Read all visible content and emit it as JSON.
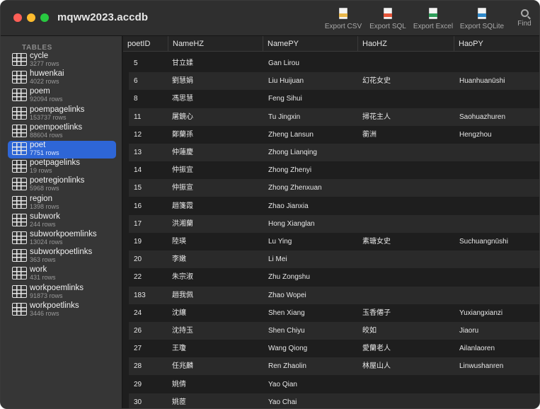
{
  "window": {
    "title": "mqww2023.accdb"
  },
  "toolbar": {
    "buttons": [
      {
        "label": "Export CSV",
        "color": "#e8b64a"
      },
      {
        "label": "Export SQL",
        "color": "#e4553a"
      },
      {
        "label": "Export Excel",
        "color": "#2f9e5a"
      },
      {
        "label": "Export SQLite",
        "color": "#2f88c9"
      },
      {
        "label": "Find"
      }
    ]
  },
  "sidebar": {
    "header": "TABLES",
    "items": [
      {
        "name": "cycle",
        "rows": "3277 rows"
      },
      {
        "name": "huwenkai",
        "rows": "4022 rows"
      },
      {
        "name": "poem",
        "rows": "92094 rows"
      },
      {
        "name": "poempagelinks",
        "rows": "153737 rows"
      },
      {
        "name": "poempoetlinks",
        "rows": "88604 rows"
      },
      {
        "name": "poet",
        "rows": "7751 rows",
        "selected": true
      },
      {
        "name": "poetpagelinks",
        "rows": "19 rows"
      },
      {
        "name": "poetregionlinks",
        "rows": "5968 rows"
      },
      {
        "name": "region",
        "rows": "1398 rows"
      },
      {
        "name": "subwork",
        "rows": "244 rows"
      },
      {
        "name": "subworkpoemlinks",
        "rows": "13024 rows"
      },
      {
        "name": "subworkpoetlinks",
        "rows": "363 rows"
      },
      {
        "name": "work",
        "rows": "431 rows"
      },
      {
        "name": "workpoemlinks",
        "rows": "91873 rows"
      },
      {
        "name": "workpoetlinks",
        "rows": "3446 rows"
      }
    ]
  },
  "table": {
    "columns": [
      "poetID",
      "NameHZ",
      "NamePY",
      "HaoHZ",
      "HaoPY"
    ],
    "rows": [
      [
        "5",
        "甘立媃",
        "Gan Lirou",
        "",
        ""
      ],
      [
        "6",
        "劉慧娟",
        "Liu Huijuan",
        "幻花女史",
        "Huanhuanūshi"
      ],
      [
        "8",
        "馮思慧",
        "Feng Sihui",
        "",
        ""
      ],
      [
        "11",
        "屠鏡心",
        "Tu Jingxin",
        "掃花主人",
        "Saohuazhuren"
      ],
      [
        "12",
        "鄭蘭孫",
        "Zheng Lansun",
        "蘅洲",
        "Hengzhou"
      ],
      [
        "13",
        "仲蓮慶",
        "Zhong Lianqing",
        "",
        ""
      ],
      [
        "14",
        "仲振宜",
        "Zhong Zhenyi",
        "",
        ""
      ],
      [
        "15",
        "仲振宣",
        "Zhong Zhenxuan",
        "",
        ""
      ],
      [
        "16",
        "趙箋霞",
        "Zhao Jianxia",
        "",
        ""
      ],
      [
        "17",
        "洪湘蘭",
        "Hong Xianglan",
        "",
        ""
      ],
      [
        "19",
        "陸瑛",
        "Lu Ying",
        "素瑭女史",
        "Suchuangnūshi"
      ],
      [
        "20",
        "李嫩",
        "Li Mei",
        "",
        ""
      ],
      [
        "22",
        "朱宗淑",
        "Zhu Zongshu",
        "",
        ""
      ],
      [
        "183",
        "趙我佩",
        "Zhao Wopei",
        "",
        ""
      ],
      [
        "24",
        "沈纕",
        "Shen Xiang",
        "玉香僊子",
        "Yuxiangxianzi"
      ],
      [
        "26",
        "沈持玉",
        "Shen Chiyu",
        "皎如",
        "Jiaoru"
      ],
      [
        "27",
        "王瓊",
        "Wang Qiong",
        "愛蘭老人",
        "Ailanlaoren"
      ],
      [
        "28",
        "任兆麟",
        "Ren Zhaolin",
        "林屋山人",
        "Linwushanren"
      ],
      [
        "29",
        "姚倩",
        "Yao Qian",
        "",
        ""
      ],
      [
        "30",
        "姚茝",
        "Yao Chai",
        "",
        ""
      ]
    ]
  }
}
